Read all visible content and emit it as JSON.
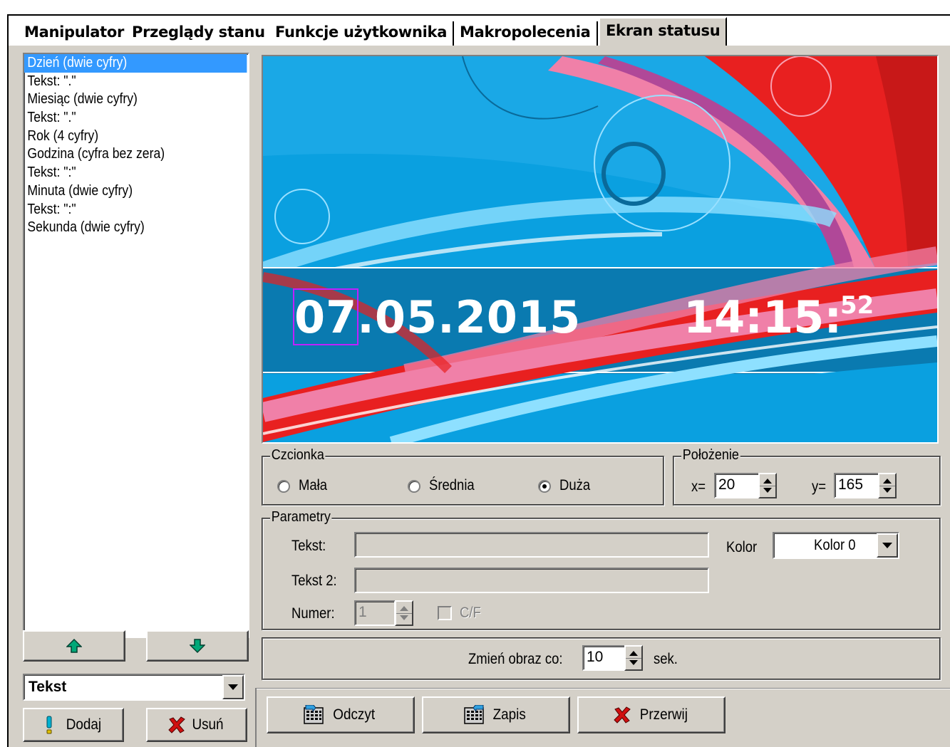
{
  "tabs": [
    {
      "label": "Manipulator"
    },
    {
      "label": "Przeglądy stanu"
    },
    {
      "label": "Funkcje użytkownika"
    },
    {
      "label": "Makropolecenia"
    },
    {
      "label": "Ekran statusu"
    }
  ],
  "list": [
    {
      "label": "Dzień (dwie cyfry)",
      "selected": true
    },
    {
      "label": "Tekst: \".\""
    },
    {
      "label": "Miesiąc (dwie cyfry)"
    },
    {
      "label": "Tekst: \".\""
    },
    {
      "label": "Rok (4 cyfry)"
    },
    {
      "label": "Godzina (cyfra bez zera)"
    },
    {
      "label": "Tekst: \":\""
    },
    {
      "label": "Minuta (dwie cyfry)"
    },
    {
      "label": "Tekst: \":\""
    },
    {
      "label": "Sekunda (dwie cyfry)"
    }
  ],
  "left": {
    "type_combo": "Tekst",
    "add_label": "Dodaj",
    "remove_label": "Usuń"
  },
  "preview": {
    "date": "07.05.2015",
    "time": "14:15:",
    "seconds": "52"
  },
  "font": {
    "legend": "Czcionka",
    "small": "Mała",
    "medium": "Średnia",
    "large": "Duża",
    "selected": "Duża"
  },
  "position": {
    "legend": "Położenie",
    "x_label": "x=",
    "x_value": "20",
    "y_label": "y=",
    "y_value": "165"
  },
  "params": {
    "legend": "Parametry",
    "text_label": "Tekst:",
    "text2_label": "Tekst 2:",
    "number_label": "Numer:",
    "number_value": "1",
    "cf_label": "C/F",
    "color_label": "Kolor",
    "color_value": "Kolor 0"
  },
  "interval": {
    "label": "Zmień obraz co:",
    "value": "10",
    "unit": "sek."
  },
  "bottom": {
    "read_label": "Odczyt",
    "write_label": "Zapis",
    "abort_label": "Przerwij"
  },
  "colors": {
    "selection": "#3399ff",
    "arrow_green": "#009966",
    "x_red": "#cc0000"
  }
}
